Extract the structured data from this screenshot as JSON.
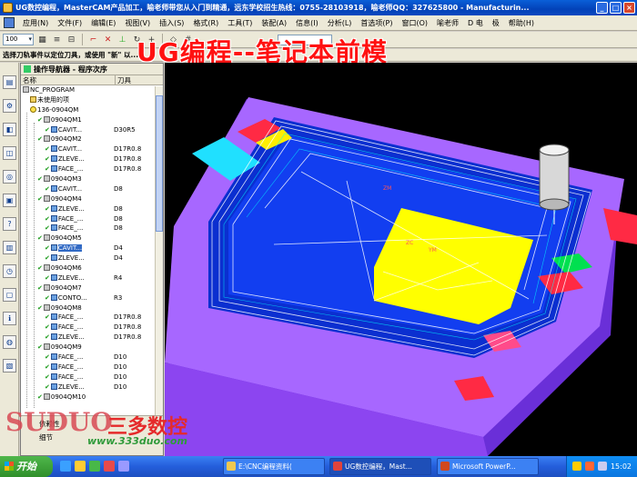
{
  "window": {
    "title": "UG数控编程，MasterCAM产品加工，喻老师带您从入门到精通，远东学校招生热线：0755-28103918，喻老师QQ：327625800 - Manufacturin..."
  },
  "menu": {
    "items": [
      "应用(N)",
      "文件(F)",
      "编辑(E)",
      "视图(V)",
      "插入(S)",
      "格式(R)",
      "工具(T)",
      "装配(A)",
      "信息(I)",
      "分析(L)",
      "首选项(P)",
      "窗口(O)",
      "喻老师",
      "D 电",
      "极",
      "帮助(H)"
    ]
  },
  "toolbar": {
    "zoom_value": "100"
  },
  "cue_line": "选择刀轨事件以定位刀具，或使用 \"新\"  以...",
  "overlay_heading": "UG编程--笔记本前模",
  "navigator": {
    "title": "操作导航器 - 程序次序",
    "col_name": "名称",
    "col_tool": "刀具",
    "bottom_label_1": "依赖性",
    "bottom_label_2": "细节",
    "rows": [
      {
        "name": "NC_PROGRAM",
        "tool": "",
        "indent": 0,
        "kind": "root"
      },
      {
        "name": "未使用的项",
        "tool": "",
        "indent": 1,
        "kind": "folder"
      },
      {
        "name": "136-0904QM",
        "tool": "",
        "indent": 1,
        "kind": "program"
      },
      {
        "name": "0904QM1",
        "tool": "",
        "indent": 2,
        "kind": "group"
      },
      {
        "name": "CAVIT...",
        "tool": "D30R5",
        "indent": 3,
        "kind": "op"
      },
      {
        "name": "0904QM2",
        "tool": "",
        "indent": 2,
        "kind": "group"
      },
      {
        "name": "CAVIT...",
        "tool": "D17R0.8",
        "indent": 3,
        "kind": "op"
      },
      {
        "name": "ZLEVE...",
        "tool": "D17R0.8",
        "indent": 3,
        "kind": "op"
      },
      {
        "name": "FACE_...",
        "tool": "D17R0.8",
        "indent": 3,
        "kind": "op"
      },
      {
        "name": "0904QM3",
        "tool": "",
        "indent": 2,
        "kind": "group"
      },
      {
        "name": "CAVIT...",
        "tool": "D8",
        "indent": 3,
        "kind": "op"
      },
      {
        "name": "0904QM4",
        "tool": "",
        "indent": 2,
        "kind": "group"
      },
      {
        "name": "ZLEVE...",
        "tool": "D8",
        "indent": 3,
        "kind": "op"
      },
      {
        "name": "FACE_...",
        "tool": "D8",
        "indent": 3,
        "kind": "op"
      },
      {
        "name": "FACE_...",
        "tool": "D8",
        "indent": 3,
        "kind": "op"
      },
      {
        "name": "0904QM5",
        "tool": "",
        "indent": 2,
        "kind": "group"
      },
      {
        "name": "CAVIT...",
        "tool": "D4",
        "indent": 3,
        "kind": "op",
        "selected": true
      },
      {
        "name": "ZLEVE...",
        "tool": "D4",
        "indent": 3,
        "kind": "op"
      },
      {
        "name": "0904QM6",
        "tool": "",
        "indent": 2,
        "kind": "group"
      },
      {
        "name": "ZLEVE...",
        "tool": "R4",
        "indent": 3,
        "kind": "op"
      },
      {
        "name": "0904QM7",
        "tool": "",
        "indent": 2,
        "kind": "group"
      },
      {
        "name": "CONTO...",
        "tool": "R3",
        "indent": 3,
        "kind": "op"
      },
      {
        "name": "0904QM8",
        "tool": "",
        "indent": 2,
        "kind": "group"
      },
      {
        "name": "FACE_...",
        "tool": "D17R0.8",
        "indent": 3,
        "kind": "op"
      },
      {
        "name": "FACE_...",
        "tool": "D17R0.8",
        "indent": 3,
        "kind": "op"
      },
      {
        "name": "ZLEVE...",
        "tool": "D17R0.8",
        "indent": 3,
        "kind": "op"
      },
      {
        "name": "0904QM9",
        "tool": "",
        "indent": 2,
        "kind": "group"
      },
      {
        "name": "FACE_...",
        "tool": "D10",
        "indent": 3,
        "kind": "op"
      },
      {
        "name": "FACE_...",
        "tool": "D10",
        "indent": 3,
        "kind": "op"
      },
      {
        "name": "FACE_...",
        "tool": "D10",
        "indent": 3,
        "kind": "op"
      },
      {
        "name": "ZLEVE...",
        "tool": "D10",
        "indent": 3,
        "kind": "op"
      },
      {
        "name": "0904QM10",
        "tool": "",
        "indent": 2,
        "kind": "group"
      }
    ]
  },
  "watermark": {
    "logo": "SUDUO",
    "chinese": "三多数控",
    "url": "www.333duo.com"
  },
  "graphics": {
    "labels": [
      "ZM",
      "ZC",
      "YM"
    ]
  },
  "taskbar": {
    "start_label": "开始",
    "tasks": [
      {
        "label": "E:\\CNC编程资料(",
        "color": "#f0c850"
      },
      {
        "label": "UG数控编程，Mast...",
        "color": "#e0433b",
        "active": true
      },
      {
        "label": "Microsoft PowerP...",
        "color": "#d0481c"
      }
    ],
    "clock": "15:02"
  },
  "colors": {
    "mold_body": "#8a4dff",
    "mold_top": "#b06cff",
    "pocket_floor": "#0a3fe0",
    "yellow_face": "#ffff00",
    "cyan_face": "#00e0ff",
    "red_face": "#ff1a44",
    "toolpath": "#ffffff"
  }
}
